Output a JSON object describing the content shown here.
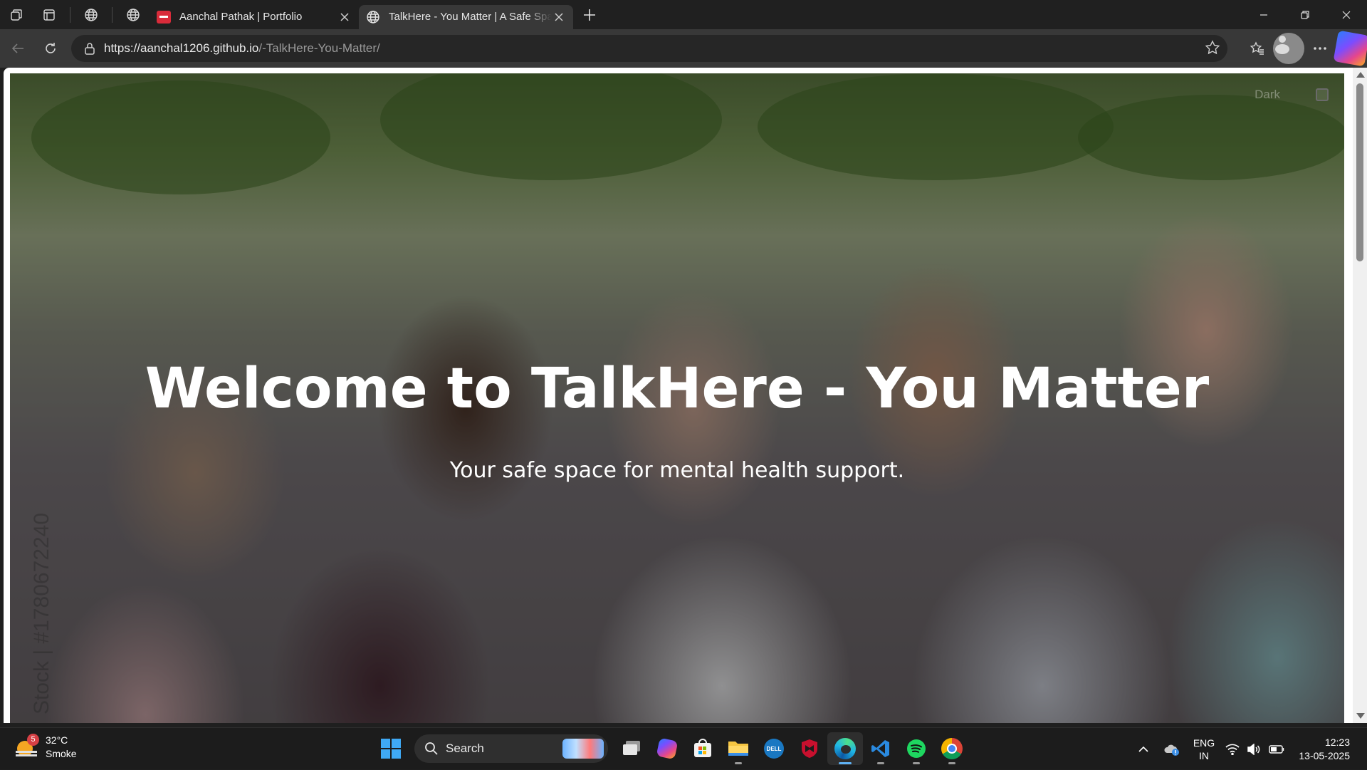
{
  "browser": {
    "tabs": [
      {
        "title": "Aanchal Pathak | Portfolio",
        "active": false
      },
      {
        "title": "TalkHere - You Matter | A Safe Space",
        "active": true
      }
    ],
    "url_host": "https://aanchal1206.github.io",
    "url_path": "/-TalkHere-You-Matter/"
  },
  "page": {
    "hero_title": "Welcome to TalkHere - You Matter",
    "hero_subtitle": "Your safe space for mental health support.",
    "dark_mode_label": "Dark",
    "dark_mode_checked": false,
    "watermark_text": "Stock | #1780672240"
  },
  "taskbar": {
    "weather_badge": "5",
    "weather_temp": "32°C",
    "weather_desc": "Smoke",
    "search_label": "Search",
    "lang_top": "ENG",
    "lang_bottom": "IN",
    "time": "12:23",
    "date": "13-05-2025"
  },
  "colors": {
    "accent": "#3fa9f5",
    "chrome_dark": "#202020",
    "toolbar": "#383838"
  }
}
